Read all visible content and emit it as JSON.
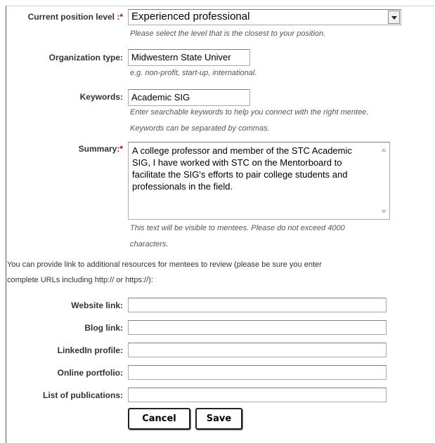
{
  "form": {
    "position_level": {
      "label": "Current position level :",
      "required_mark": "*",
      "value": "Experienced professional",
      "hint": "Please select the level that is the closest to your position."
    },
    "organization_type": {
      "label": "Organization type:",
      "value": "Midwestern State Univer",
      "hint": "e.g. non-profit, start-up, international."
    },
    "keywords": {
      "label": "Keywords:",
      "value": "Academic SIG",
      "hint_line1": "Enter searchable keywords to help you connect with the right mentee.",
      "hint_line2": "Keywords can be separated by commas."
    },
    "summary": {
      "label": "Summary:",
      "required_mark": "*",
      "value": "A college professor and member of the STC Academic SIG, I have worked with STC on the Mentorboard to facilitate the SIG's efforts to pair college students and professionals in the field.",
      "hint_line1": "This text will be visible to mentees. Please do not exceed 4000",
      "hint_line2": "characters."
    },
    "resources_intro_line1": "You can provide link to additional resources for mentees to review (please be sure you enter",
    "resources_intro_line2": "complete URLs including http:// or https://):",
    "links": [
      {
        "label": "Website link:",
        "value": ""
      },
      {
        "label": "Blog link:",
        "value": ""
      },
      {
        "label": "LinkedIn profile:",
        "value": ""
      },
      {
        "label": "Online portfolio:",
        "value": ""
      },
      {
        "label": "List of publications:",
        "value": ""
      }
    ],
    "buttons": {
      "cancel_label": "Cancel",
      "save_label": "Save"
    }
  }
}
